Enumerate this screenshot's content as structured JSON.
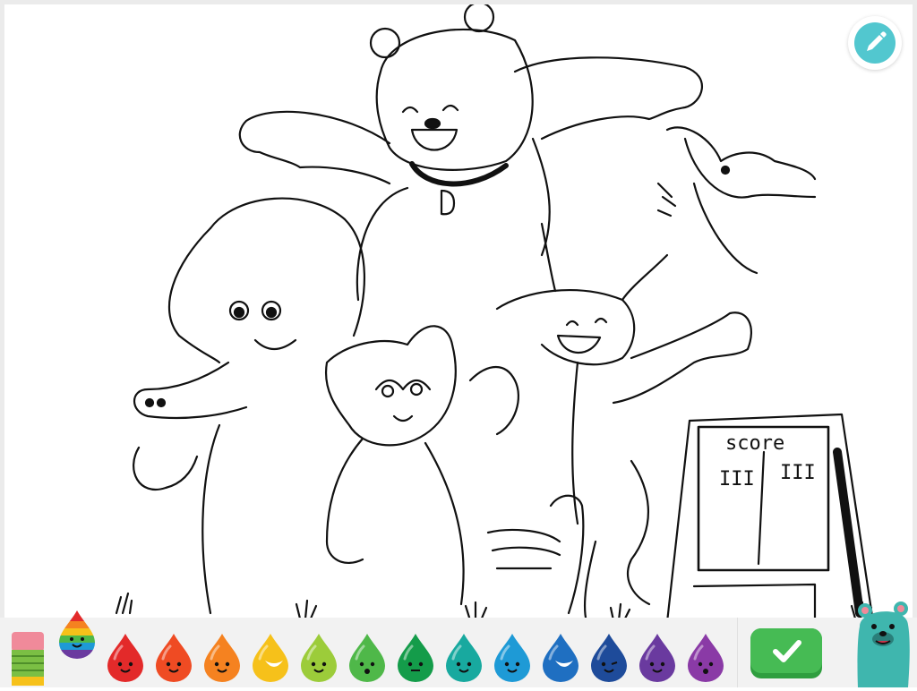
{
  "app": {
    "scene": "coloring-page",
    "ground_color": "#e8e8e8"
  },
  "scoreboard": {
    "title": "score",
    "left_tally": "III",
    "right_tally": "III"
  },
  "tools": {
    "pencil_icon": "pencil-icon",
    "eraser_icon": "eraser-icon",
    "rainbow_icon": "rainbow-drop-icon",
    "done_icon": "checkmark-icon",
    "mascot_icon": "teal-bear-mascot"
  },
  "palette": [
    {
      "name": "red",
      "color": "#e32a2a",
      "face": "smile"
    },
    {
      "name": "red-orange",
      "color": "#ef4b23",
      "face": "smile"
    },
    {
      "name": "orange",
      "color": "#f58220",
      "face": "smile"
    },
    {
      "name": "yellow",
      "color": "#f6c11a",
      "face": "crescent"
    },
    {
      "name": "lime",
      "color": "#9ccc3a",
      "face": "smile"
    },
    {
      "name": "green",
      "color": "#4fb849",
      "face": "surprised"
    },
    {
      "name": "dark-green",
      "color": "#149c4a",
      "face": "flat"
    },
    {
      "name": "teal",
      "color": "#18a99f",
      "face": "smile"
    },
    {
      "name": "sky-blue",
      "color": "#1e9ad6",
      "face": "smile"
    },
    {
      "name": "blue",
      "color": "#1f6fc1",
      "face": "crescent"
    },
    {
      "name": "navy",
      "color": "#1e4b9a",
      "face": "wink"
    },
    {
      "name": "purple",
      "color": "#6a3a9f",
      "face": "smile"
    },
    {
      "name": "violet",
      "color": "#8a3aa6",
      "face": "surprised"
    }
  ],
  "accents": {
    "done_green": "#46bb54",
    "pencil_teal": "#52c7cf",
    "mascot_teal": "#3fb6ae"
  }
}
